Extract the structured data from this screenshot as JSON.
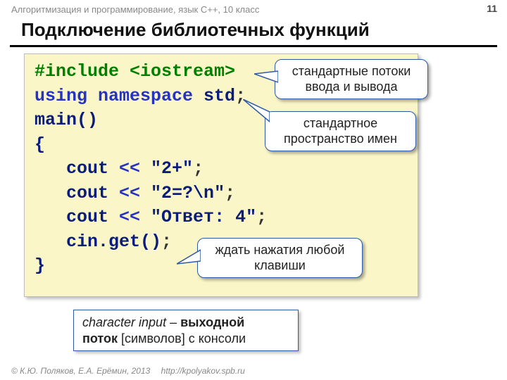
{
  "header": {
    "course": "Алгоритмизация и программирование, язык  C++, 10 класс",
    "page": "11",
    "title": "Подключение библиотечных функций"
  },
  "code": {
    "l1a": "#include ",
    "l1b": "<iostream>",
    "l2a": "using",
    "l2b": " namespace ",
    "l2c": "std",
    "l2d": ";",
    "l3": "main()",
    "l4": "{",
    "l5a": "   cout ",
    "l5b": "<<",
    "l5c": " \"2+\"",
    "l5d": ";",
    "l6a": "   cout ",
    "l6b": "<<",
    "l6c": " \"2=?\\n\"",
    "l6d": ";",
    "l7a": "   cout ",
    "l7b": "<<",
    "l7c": " \"Ответ: 4\"",
    "l7d": ";",
    "l8a": "   cin.get()",
    "l8b": ";",
    "l9": "}"
  },
  "callouts": {
    "iostream_l1": "стандартные потоки",
    "iostream_l2": "ввода и вывода",
    "std_l1": "стандартное",
    "std_l2": "пространство имен",
    "cin_l1": "ждать нажатия любой",
    "cin_l2": "клавиши"
  },
  "infobox": {
    "ital": "character input",
    "dash": " – ",
    "b1": "выходной",
    "b2": "поток",
    "rest": " [символов] с консоли"
  },
  "footer": {
    "copyright": "© К.Ю. Поляков, Е.А. Ерёмин, 2013",
    "url": "http://kpolyakov.spb.ru"
  }
}
